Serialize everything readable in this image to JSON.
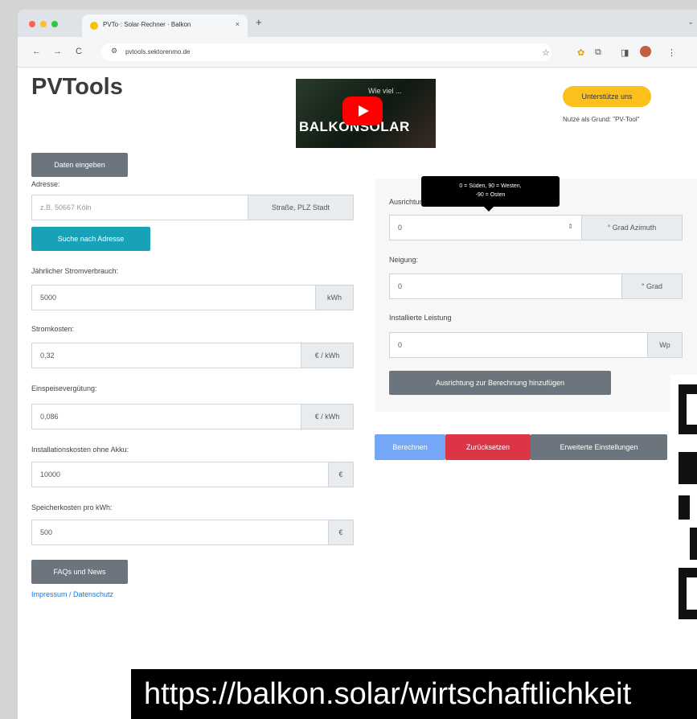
{
  "browser": {
    "tab_title": "PVTo·: Solar·Rechner · Balkon",
    "tab_close": "×",
    "new_tab": "+",
    "url": "pvtools.sektorenmo.de",
    "back": "←",
    "forward": "→",
    "reload": "C",
    "star": "☆"
  },
  "header": {
    "logo": "PVTools",
    "video_caption": "Wie viel ...",
    "video_brand": "BALKONSOLAR",
    "support_button": "Unterstütze uns",
    "support_note": "Nutze als Grund: \"PV-Tool\""
  },
  "form": {
    "enter_data_button": "Daten eingeben",
    "address_label": "Adresse:",
    "address_placeholder": "z.B. 50667 Köln",
    "address_addon": "Straße, PLZ Stadt",
    "search_button": "Suche nach Adresse",
    "consumption_label": "Jährlicher Stromverbrauch:",
    "consumption_value": "5000",
    "consumption_unit": "kWh",
    "cost_label": "Stromkosten:",
    "cost_value": "0,32",
    "cost_unit": "€ / kWh",
    "feedin_label": "Einspeisevergütung:",
    "feedin_value": "0,086",
    "feedin_unit": "€ / kWh",
    "install_label": "Installationskosten ohne Akku:",
    "install_value": "10000",
    "install_unit": "€",
    "storage_label": "Speicherkosten pro kWh:",
    "storage_value": "500",
    "storage_unit": "€",
    "faq_button": "FAQs und News",
    "imprint_link": "Impressum / Datenschutz"
  },
  "orientation": {
    "tooltip_line1": "0 = Süden, 90 = Westen,",
    "tooltip_line2": "-90 = Osten",
    "label": "Ausrichtung:",
    "value": "0",
    "unit": "° Grad Azimuth",
    "tilt_label": "Neigung:",
    "tilt_value": "0",
    "tilt_unit": "° Grad",
    "power_label": "Installierte Leistung",
    "power_value": "0",
    "power_unit": "Wp",
    "add_button": "Ausrichtung zur Berechnung hinzufügen"
  },
  "actions": {
    "calculate": "Berechnen",
    "reset": "Zurücksetzen",
    "advanced": "Erweiterte Einstellungen"
  },
  "overlay_url": "https://balkon.solar/wirtschaftlichkeit",
  "colors": {
    "teal": "#17a2b8",
    "grey": "#6c757d",
    "red": "#dc3545",
    "yellow": "#fcc01d",
    "blue": "#74a7f6"
  }
}
